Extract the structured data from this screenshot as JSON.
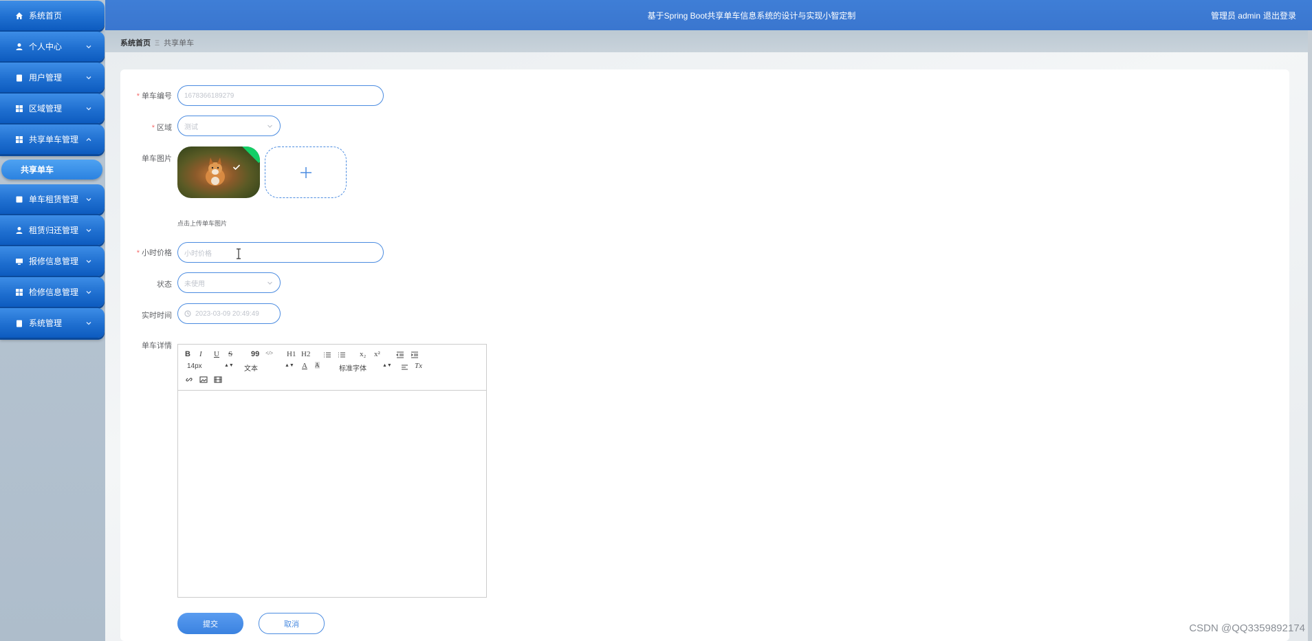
{
  "header": {
    "title": "基于Spring Boot共享单车信息系统的设计与实现小智定制",
    "user": "管理员 admin",
    "logout": "退出登录"
  },
  "sidebar": {
    "items": [
      {
        "label": "系统首页",
        "icon": "home-icon"
      },
      {
        "label": "个人中心",
        "icon": "user-icon"
      },
      {
        "label": "用户管理",
        "icon": "clipboard-icon"
      },
      {
        "label": "区域管理",
        "icon": "grid-icon"
      },
      {
        "label": "共享单车管理",
        "icon": "grid-icon"
      },
      {
        "label": "单车租赁管理",
        "icon": "chart-icon"
      },
      {
        "label": "租赁归还管理",
        "icon": "person-icon"
      },
      {
        "label": "报修信息管理",
        "icon": "monitor-icon"
      },
      {
        "label": "检修信息管理",
        "icon": "grid-icon"
      },
      {
        "label": "系统管理",
        "icon": "clipboard-icon"
      }
    ],
    "active_sub": "共享单车"
  },
  "breadcrumb": {
    "home": "系统首页",
    "separator": "Ξ",
    "current": "共享单车"
  },
  "form": {
    "bike_no": {
      "label": "单车编号",
      "value": "1678366189279"
    },
    "area": {
      "label": "区域",
      "value": "测试"
    },
    "image": {
      "label": "单车图片",
      "hint": "点击上传单车图片"
    },
    "price": {
      "label": "小时价格",
      "placeholder": "小时价格"
    },
    "status": {
      "label": "状态",
      "value": "未使用"
    },
    "time": {
      "label": "实时时间",
      "value": "2023-03-09 20:49:49"
    },
    "detail": {
      "label": "单车详情"
    }
  },
  "editor": {
    "font_size": "14px",
    "text_type": "文本",
    "font_family": "标准字体",
    "buttons": [
      "B",
      "I",
      "U",
      "S",
      "99",
      "</>",
      "H1",
      "H2",
      "x₂",
      "x²",
      "A",
      "A",
      "Tx"
    ]
  },
  "actions": {
    "submit": "提交",
    "cancel": "取消"
  },
  "watermark": "CSDN @QQ3359892174",
  "colors": {
    "header": "#3f7ed6",
    "menu": "#1f6fd0",
    "accent": "#4a8be0",
    "required": "#f56c6c"
  }
}
